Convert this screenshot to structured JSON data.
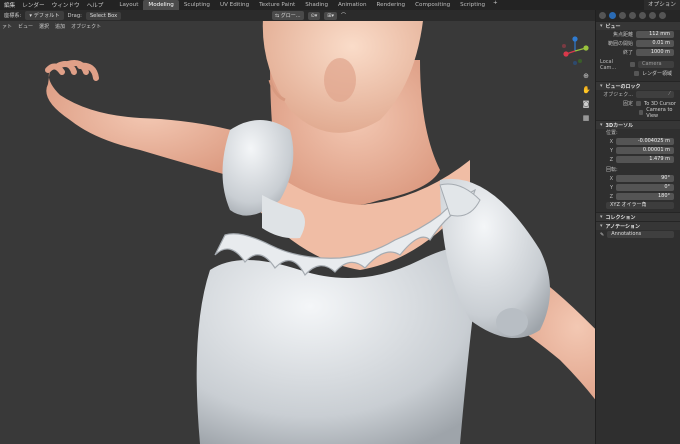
{
  "topbar": {
    "menus": [
      "編集",
      "レンダー",
      "ウィンドウ",
      "ヘルプ"
    ],
    "tabs": [
      "Layout",
      "Modeling",
      "Sculpting",
      "UV Editing",
      "Texture Paint",
      "Shading",
      "Animation",
      "Rendering",
      "Compositing",
      "Scripting"
    ],
    "active_tab": "Modeling",
    "add_tab": "+",
    "right_label": "オプション"
  },
  "header1": {
    "mode": "座標系:",
    "orientation": "デフォルト",
    "drag_label": "Drag:",
    "drag_value": "Select Box"
  },
  "header2": {
    "items": [
      "ァト",
      "ビュー",
      "選択",
      "追加",
      "オブジェクト"
    ]
  },
  "overlay": {
    "transform": "グロー..."
  },
  "sidebar": {
    "view_header": "ビュー",
    "focal_label": "焦点距離",
    "focal_value": "112 mm",
    "clip_start_label": "範囲の開始",
    "clip_start_value": "0.01 m",
    "clip_end_label": "終了",
    "clip_end_value": "1000 m",
    "local_cam_label": "Local Cam...",
    "camera_placeholder": "Camera",
    "render_region": "レンダー領域",
    "lock_header": "ビューのロック",
    "object_label": "オブジェク...",
    "lock_label": "固定",
    "to_cursor": "To 3D Cursor",
    "camera_to_view": "Camera to View",
    "cursor_header": "3Dカーソル",
    "location_label": "位置:",
    "loc_x": "-0.004025 m",
    "loc_y": "0.00001 m",
    "loc_z": "1.479 m",
    "rotation_label": "回転:",
    "rot_x": "90°",
    "rot_y": "0°",
    "rot_z": "180°",
    "rotation_mode": "XYZ オイラー角",
    "collection_header": "コレクション",
    "annotation_header": "アノテーション",
    "annotation_value": "Annotations"
  },
  "colors": {
    "accent": "#4a7bbf",
    "active_tab": "#4b4b4b"
  }
}
